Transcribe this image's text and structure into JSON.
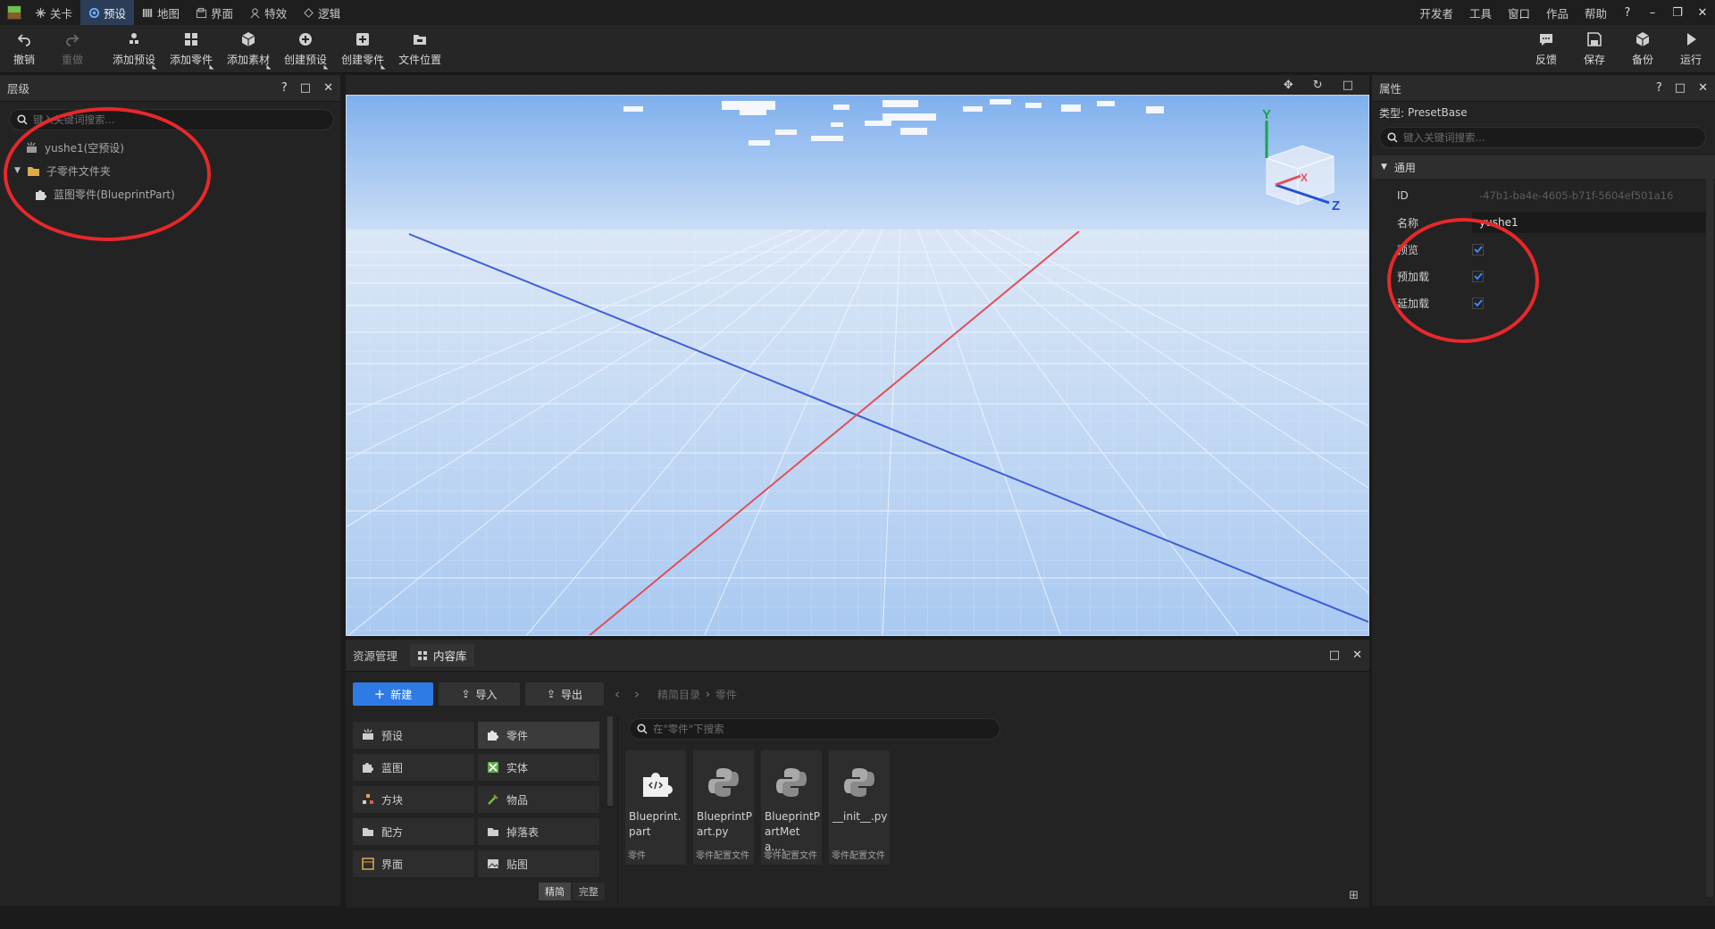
{
  "menubar": {
    "tabs": [
      {
        "label": "关卡",
        "icon": "level-icon"
      },
      {
        "label": "预设",
        "icon": "preset-icon"
      },
      {
        "label": "地图",
        "icon": "map-icon"
      },
      {
        "label": "界面",
        "icon": "ui-icon"
      },
      {
        "label": "特效",
        "icon": "effects-icon"
      },
      {
        "label": "逻辑",
        "icon": "logic-icon"
      }
    ],
    "right_items": [
      "开发者",
      "工具",
      "窗口",
      "作品",
      "帮助"
    ],
    "help_symbol": "?",
    "window_buttons": [
      "–",
      "❐",
      "✕"
    ]
  },
  "toolbar": {
    "undo": "撤销",
    "redo": "重做",
    "add_preset": "添加预设",
    "add_part": "添加零件",
    "add_asset": "添加素材",
    "create_preset": "创建预设",
    "create_part": "创建零件",
    "file_location": "文件位置",
    "feedback": "反馈",
    "save": "保存",
    "backup": "备份",
    "run": "运行"
  },
  "hierarchy": {
    "title": "层级",
    "search_placeholder": "键入关键词搜索...",
    "items": [
      {
        "label": "yushe1(空预设)",
        "icon": "preset-icon"
      },
      {
        "label": "子零件文件夹",
        "icon": "folder-icon"
      },
      {
        "label": "蓝图零件(BlueprintPart)",
        "icon": "puzzle-icon"
      }
    ]
  },
  "viewport": {
    "axes": {
      "y": "Y",
      "z": "Z",
      "x": "X"
    }
  },
  "properties": {
    "title": "属性",
    "type_label": "类型:",
    "type_value": "PresetBase",
    "search_placeholder": "键入关键词搜索...",
    "section": "通用",
    "id_label": "ID",
    "id_value": "-47b1-ba4e-4605-b71f-5604ef501a16",
    "name_label": "名称",
    "name_value": "yushe1",
    "checkboxes": [
      {
        "label": "预览",
        "checked": true
      },
      {
        "label": "预加载",
        "checked": true
      },
      {
        "label": "延加载",
        "checked": true
      }
    ]
  },
  "content": {
    "tabs": [
      "资源管理",
      "内容库"
    ],
    "new_button": "新建",
    "import_button": "导入",
    "export_button": "导出",
    "breadcrumb": [
      "精简目录",
      "零件"
    ],
    "search_placeholder": "在\"零件\"下搜索",
    "categories": [
      {
        "label": "预设",
        "icon": "preset-icon"
      },
      {
        "label": "零件",
        "icon": "puzzle-icon"
      },
      {
        "label": "蓝图",
        "icon": "blueprint-icon"
      },
      {
        "label": "实体",
        "icon": "entity-icon"
      },
      {
        "label": "方块",
        "icon": "block-icon"
      },
      {
        "label": "物品",
        "icon": "item-icon"
      },
      {
        "label": "配方",
        "icon": "folder-icon"
      },
      {
        "label": "掉落表",
        "icon": "folder-icon"
      },
      {
        "label": "界面",
        "icon": "ui-icon"
      },
      {
        "label": "贴图",
        "icon": "texture-icon"
      }
    ],
    "view_modes": [
      "精简",
      "完整"
    ],
    "assets": [
      {
        "name": "Blueprint.part",
        "sub": "零件",
        "icon": "puzzle-icon"
      },
      {
        "name": "BlueprintPart.py",
        "sub": "零件配置文件",
        "icon": "python-icon"
      },
      {
        "name": "BlueprintPartMeta....",
        "sub": "零件配置文件",
        "icon": "python-icon"
      },
      {
        "name": "__init__.py",
        "sub": "零件配置文件",
        "icon": "python-icon"
      }
    ]
  },
  "colors": {
    "accent": "#2f7be6",
    "annotation": "#e8282a",
    "sky": "#b9d4f6",
    "axis_red": "#e0505a",
    "axis_blue": "#3f5fd8"
  }
}
